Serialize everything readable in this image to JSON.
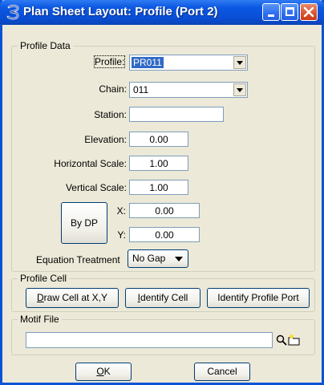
{
  "window": {
    "title": "Plan Sheet Layout: Profile (Port 2)"
  },
  "title_buttons": {
    "minimize": "minimize",
    "maximize": "maximize",
    "close": "close"
  },
  "profile_data": {
    "legend": "Profile Data",
    "profile_label": "Profile:",
    "profile_value": "PR011",
    "chain_label": "Chain:",
    "chain_value": "011",
    "station_label": "Station:",
    "station_value": "",
    "elevation_label": "Elevation:",
    "elevation_value": "0.00",
    "hscale_label": "Horizontal Scale:",
    "hscale_value": "1.00",
    "vscale_label": "Vertical Scale:",
    "vscale_value": "1.00",
    "bydp_label": "By DP",
    "x_label": "X:",
    "x_value": "0.00",
    "y_label": "Y:",
    "y_value": "0.00",
    "equation_label": "Equation Treatment",
    "equation_value": "No Gap"
  },
  "profile_cell": {
    "legend": "Profile Cell",
    "draw_first": "D",
    "draw_rest": "raw Cell at X,Y",
    "identify_first": "I",
    "identify_rest": "dentify Cell",
    "identify_port": "Identify Profile Port"
  },
  "motif_file": {
    "legend": "Motif File",
    "value": "",
    "search_icon": "search-icon",
    "folder_icon": "folder-icon"
  },
  "footer": {
    "ok_first": "O",
    "ok_rest": "K",
    "cancel": "Cancel"
  }
}
